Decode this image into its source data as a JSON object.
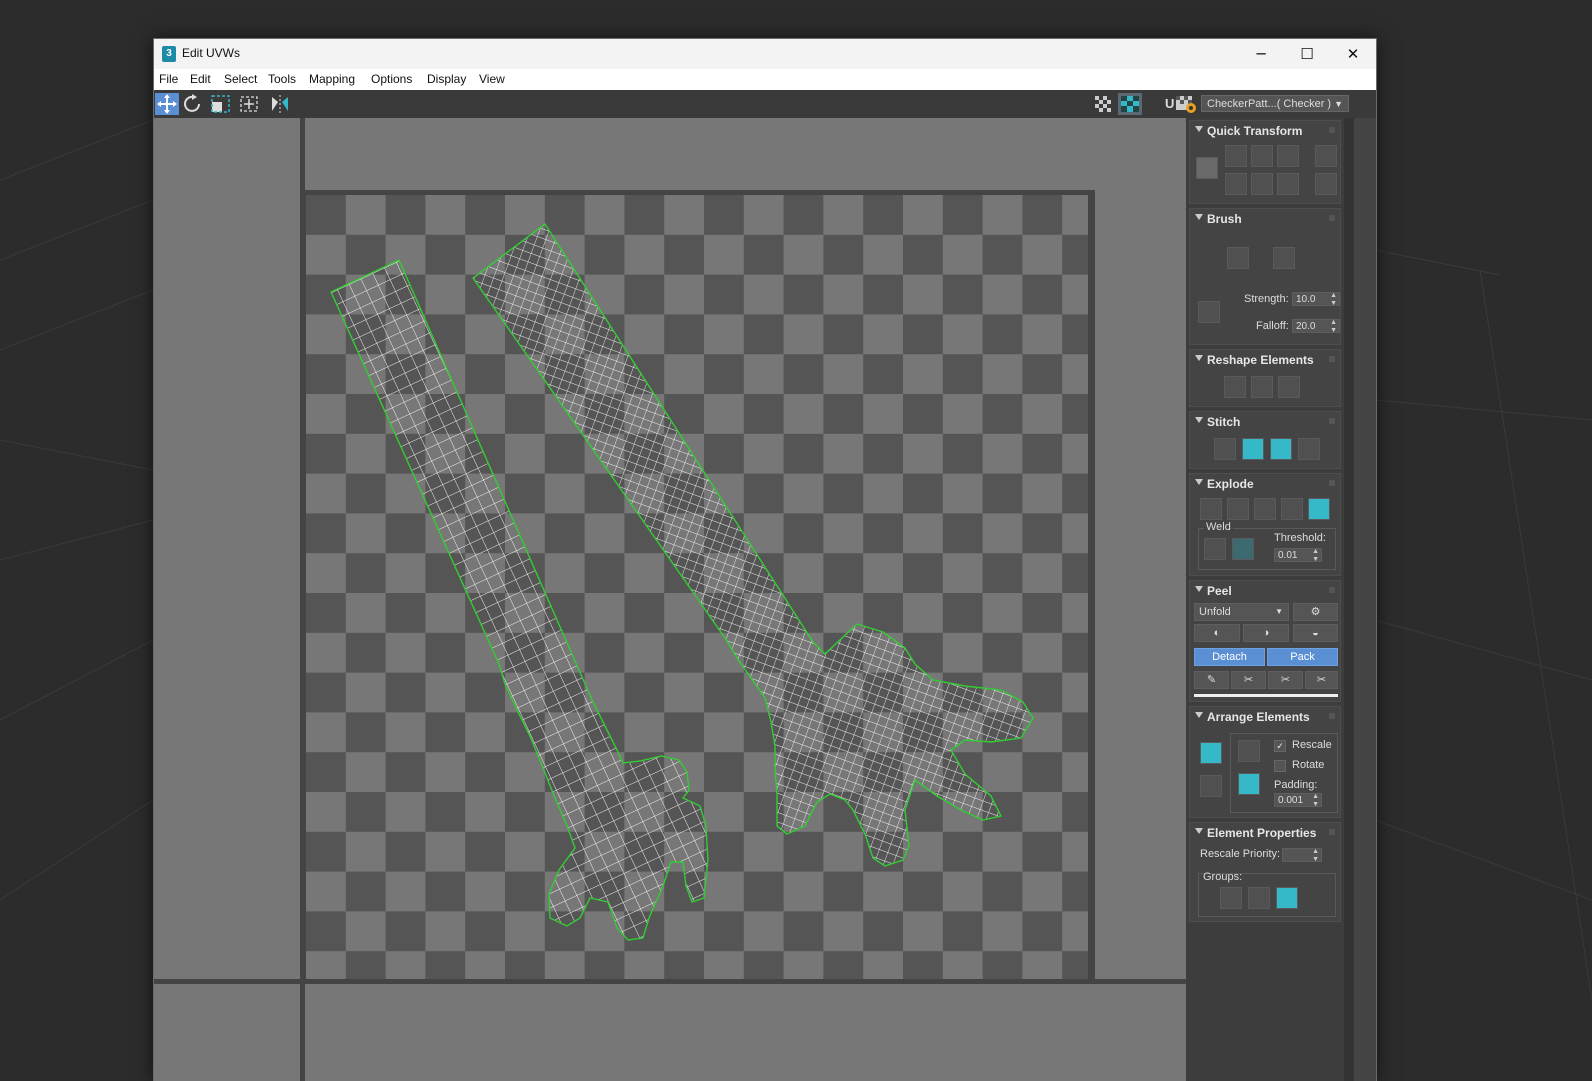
{
  "window": {
    "title": "Edit UVWs",
    "app_icon": "3"
  },
  "window_controls": {
    "minimize": "─",
    "maximize": "☐",
    "close": "✕"
  },
  "menu": [
    "File",
    "Edit",
    "Select",
    "Tools",
    "Mapping",
    "Options",
    "Display",
    "View"
  ],
  "toolbar": {
    "tools": [
      "move-tool-icon",
      "rotate-tool-icon",
      "scale-tool-icon",
      "freeform-tool-icon",
      "mirror-tool-icon"
    ],
    "uv_label": "UV",
    "texture_combo": "CheckerPatt...( Checker )"
  },
  "colors": {
    "accent": "#5b8fd4",
    "uv_edge": "#ffffff",
    "uv_border": "#33cc33",
    "checker_dark": "#555555",
    "checker_light": "#777777",
    "icon_teal": "#35b8c8"
  },
  "panel": {
    "quick_transform": {
      "title": "Quick Transform"
    },
    "brush": {
      "title": "Brush",
      "strength_label": "Strength:",
      "strength": "10.0",
      "falloff_label": "Falloff:",
      "falloff": "20.0"
    },
    "reshape": {
      "title": "Reshape Elements"
    },
    "stitch": {
      "title": "Stitch"
    },
    "explode": {
      "title": "Explode",
      "weld_label": "Weld",
      "threshold_label": "Threshold:",
      "threshold": "0.01"
    },
    "peel": {
      "title": "Peel",
      "mode": "Unfold",
      "detach": "Detach",
      "pack": "Pack"
    },
    "arrange": {
      "title": "Arrange Elements",
      "rescale": "Rescale",
      "rescale_checked": true,
      "rotate": "Rotate",
      "rotate_checked": false,
      "padding_label": "Padding:",
      "padding": "0.001"
    },
    "element_props": {
      "title": "Element Properties",
      "rescale_priority_label": "Rescale Priority:",
      "groups_label": "Groups:"
    }
  }
}
